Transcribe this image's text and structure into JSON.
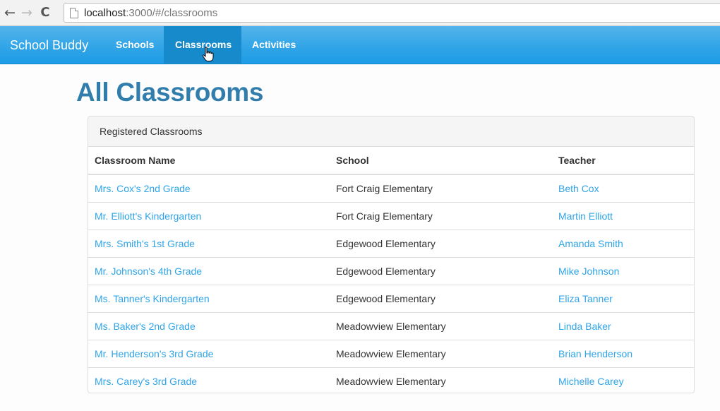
{
  "browser": {
    "back_icon": "←",
    "forward_icon": "→",
    "reload_icon": "C",
    "url_host": "localhost",
    "url_rest": ":3000/#/classrooms"
  },
  "navbar": {
    "brand": "School Buddy",
    "links": [
      "Schools",
      "Classrooms",
      "Activities"
    ],
    "active": "Classrooms",
    "accent_color": "#2fa4e7"
  },
  "page": {
    "title": "All Classrooms",
    "panel_heading": "Registered Classrooms"
  },
  "table": {
    "headers": [
      "Classroom Name",
      "School",
      "Teacher"
    ],
    "rows": [
      [
        "Mrs. Cox's 2nd Grade",
        "Fort Craig Elementary",
        "Beth Cox"
      ],
      [
        "Mr. Elliott's Kindergarten",
        "Fort Craig Elementary",
        "Martin Elliott"
      ],
      [
        "Mrs. Smith's 1st Grade",
        "Edgewood Elementary",
        "Amanda Smith"
      ],
      [
        "Mr. Johnson's 4th Grade",
        "Edgewood Elementary",
        "Mike Johnson"
      ],
      [
        "Ms. Tanner's Kindergarten",
        "Edgewood Elementary",
        "Eliza Tanner"
      ],
      [
        "Ms. Baker's 2nd Grade",
        "Meadowview Elementary",
        "Linda Baker"
      ],
      [
        "Mr. Henderson's 3rd Grade",
        "Meadowview Elementary",
        "Brian Henderson"
      ],
      [
        "Mrs. Carey's 3rd Grade",
        "Meadowview Elementary",
        "Michelle Carey"
      ]
    ]
  }
}
